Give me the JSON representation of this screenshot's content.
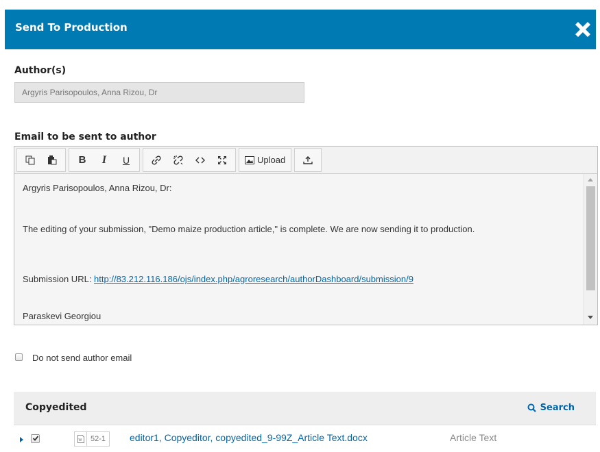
{
  "modal": {
    "title": "Send To Production",
    "close_icon": "close-x-icon"
  },
  "authors": {
    "label": "Author(s)",
    "value": "Argyris Parisopoulos, Anna Rizou, Dr"
  },
  "email": {
    "label": "Email to be sent to author",
    "toolbar": {
      "copy_icon": "copy-icon",
      "paste_icon": "paste-icon",
      "bold": "B",
      "italic": "I",
      "underline": "U",
      "link_icon": "link-icon",
      "unlink_icon": "unlink-icon",
      "code_icon": "code-icon",
      "fullscreen_icon": "fullscreen-icon",
      "upload_label": "Upload",
      "upload_icon": "image-icon",
      "insert_icon": "insert-variable-icon"
    },
    "body": {
      "greeting": "Argyris Parisopoulos, Anna Rizou, Dr:",
      "paragraph": "The editing of your submission, \"Demo maize production article,\" is complete. We are now sending it to production.",
      "url_label": "Submission URL: ",
      "url": "http://83.212.116.186/ojs/index.php/agroresearch/authorDashboard/submission/9",
      "signature": "Paraskevi Georgiou"
    }
  },
  "skip_email": {
    "label": "Do not send author email",
    "checked": false
  },
  "grid": {
    "title": "Copyedited",
    "search_label": "Search",
    "rows": [
      {
        "checked": true,
        "file_id": "52-1",
        "file_name": "editor1, Copyeditor, copyedited_9-99Z_Article Text.docx",
        "genre": "Article Text"
      }
    ]
  },
  "colors": {
    "header": "#007ab2",
    "link": "#0066a8"
  }
}
